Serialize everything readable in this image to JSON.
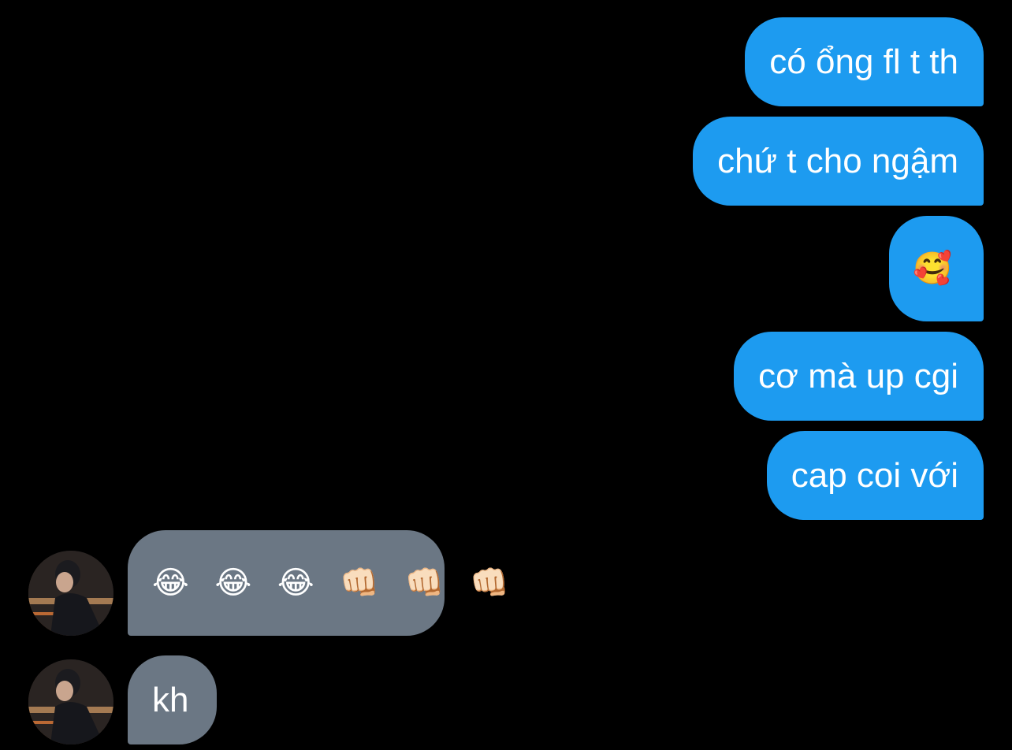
{
  "conversation": {
    "outgoing": [
      {
        "text": "có ổng fl t th"
      },
      {
        "text": "chứ t cho ngậm"
      },
      {
        "text": "🥰"
      },
      {
        "text": "cơ mà up cgi"
      },
      {
        "text": "cap coi với"
      }
    ],
    "incoming": [
      {
        "text": "😂 😂 😂 👊🏻 👊🏻 👊🏻"
      },
      {
        "text": "kh"
      }
    ]
  },
  "colors": {
    "background": "#000000",
    "outgoing_bubble": "#1d9bf0",
    "incoming_bubble": "#6b7784",
    "text": "#ffffff"
  },
  "icons": {
    "avatar": "user-photo-avatar"
  }
}
